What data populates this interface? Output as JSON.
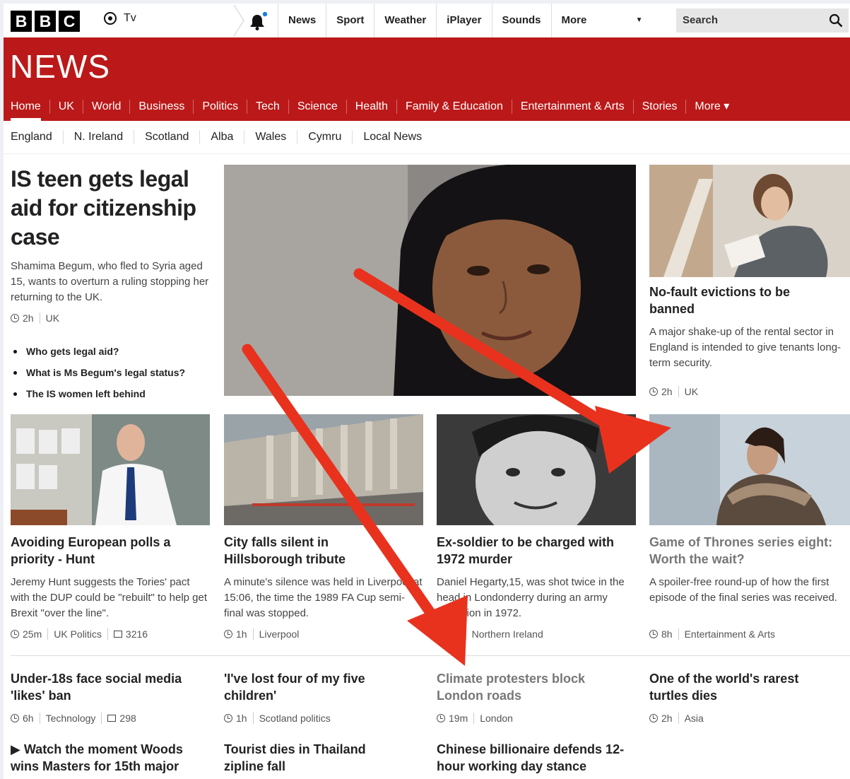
{
  "brand": {
    "logo_letters": [
      "B",
      "B",
      "C"
    ]
  },
  "topbar": {
    "tv_label": "Tv",
    "nav": [
      "News",
      "Sport",
      "Weather",
      "iPlayer",
      "Sounds",
      "More"
    ],
    "search_placeholder": "Search"
  },
  "header": {
    "title": "NEWS",
    "nav": [
      "Home",
      "UK",
      "World",
      "Business",
      "Politics",
      "Tech",
      "Science",
      "Health",
      "Family & Education",
      "Entertainment & Arts",
      "Stories",
      "More"
    ],
    "active": "Home"
  },
  "subnav": [
    "England",
    "N. Ireland",
    "Scotland",
    "Alba",
    "Wales",
    "Cymru",
    "Local News"
  ],
  "lead": {
    "headline": "IS teen gets legal aid for citizenship case",
    "summary": "Shamima Begum, who fled to Syria aged 15, wants to overturn a ruling stopping her returning to the UK.",
    "time": "2h",
    "section": "UK",
    "related": [
      "Who gets legal aid?",
      "What is Ms Begum's legal status?",
      "The IS women left behind"
    ]
  },
  "side_story": {
    "headline": "No-fault evictions to be banned",
    "summary": "A major shake-up of the rental sector in England is intended to give tenants long-term security.",
    "time": "2h",
    "section": "UK"
  },
  "row_stories": [
    {
      "headline": "Avoiding European polls a priority - Hunt",
      "summary": "Jeremy Hunt suggests the Tories' pact with the DUP could be \"rebuilt\" to help get Brexit \"over the line\".",
      "time": "25m",
      "section": "UK Politics",
      "comments": "3216"
    },
    {
      "headline": "City falls silent in Hillsborough tribute",
      "summary": "A minute's silence was held in Liverpool at 15:06, the time the 1989 FA Cup semi-final was stopped.",
      "time": "1h",
      "section": "Liverpool"
    },
    {
      "headline": "Ex-soldier to be charged with 1972 murder",
      "summary": "Daniel Hegarty,15, was shot twice in the head in Londonderry during an army operation in 1972.",
      "time": "1h",
      "section": "Northern Ireland"
    },
    {
      "headline": "Game of Thrones series eight: Worth the wait?",
      "summary": "A spoiler-free round-up of how the first episode of the final series was received.",
      "time": "8h",
      "section": "Entertainment & Arts"
    }
  ],
  "text_stories": [
    {
      "headline": "Under-18s face social media 'likes' ban",
      "time": "6h",
      "section": "Technology",
      "comments": "298"
    },
    {
      "headline": "'I've lost four of my five children'",
      "time": "1h",
      "section": "Scotland politics"
    },
    {
      "headline": "Climate protesters block London roads",
      "time": "19m",
      "section": "London"
    },
    {
      "headline": "One of the world's rarest turtles dies",
      "time": "2h",
      "section": "Asia"
    }
  ],
  "bottom_stories": [
    {
      "headline": "Watch the moment Woods wins Masters for 15th major",
      "marker": "▶"
    },
    {
      "headline": "Tourist dies in Thailand zipline fall"
    },
    {
      "headline": "Chinese billionaire defends 12-hour working day stance"
    }
  ],
  "colors": {
    "brand_red": "#bb1919",
    "annotation_arrow": "#e8321e",
    "notification_dot": "#1380e8"
  },
  "icons": [
    "user-circle-icon",
    "bell-icon",
    "search-icon",
    "clock-icon",
    "comment-icon",
    "play-icon",
    "arrow-annotation"
  ]
}
